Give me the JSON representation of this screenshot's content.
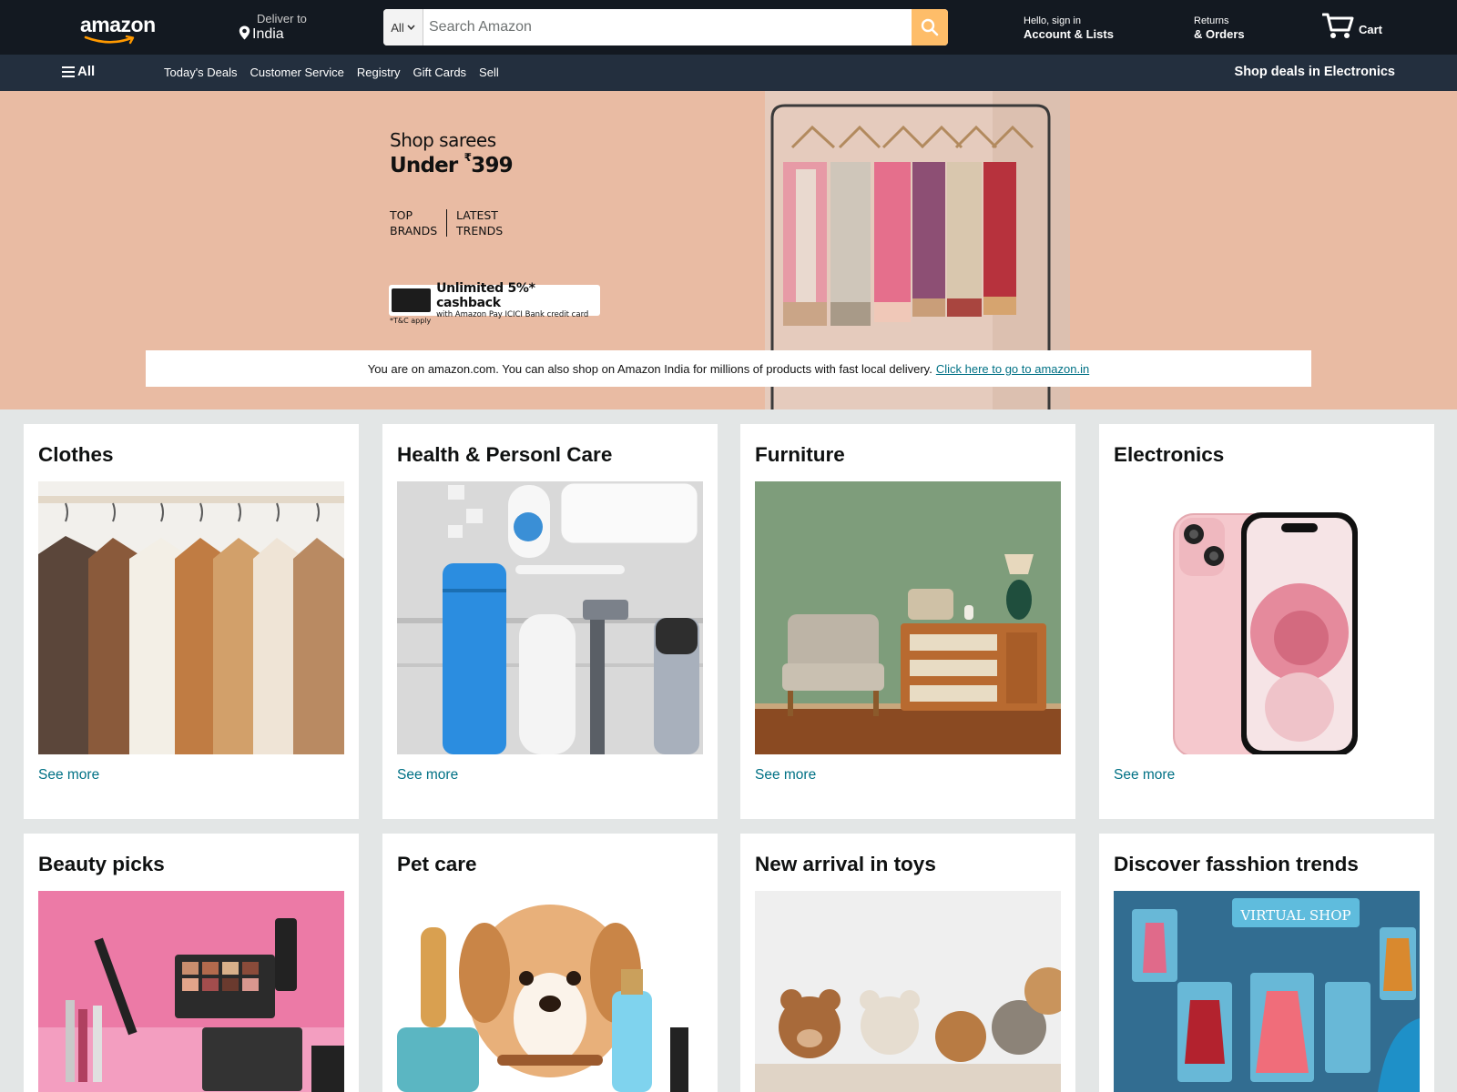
{
  "header": {
    "logo_text": "amazon",
    "deliver_label": "Deliver to",
    "deliver_location": "India",
    "search": {
      "category": "All",
      "placeholder": "Search Amazon"
    },
    "account": {
      "greeting": "Hello, sign in",
      "label": "Account & Lists"
    },
    "returns": {
      "line1": "Returns",
      "line2": "& Orders"
    },
    "cart": {
      "label": "Cart"
    }
  },
  "subnav": {
    "all_label": "All",
    "links": [
      "Today's Deals",
      "Customer Service",
      "Registry",
      "Gift Cards",
      "Sell"
    ],
    "promo": "Shop deals in Electronics"
  },
  "hero": {
    "line1": "Shop sarees",
    "price_prefix": "Under ",
    "price_symbol": "₹",
    "price_value": "399",
    "tag_left_1": "TOP",
    "tag_left_2": "BRANDS",
    "tag_right_1": "LATEST",
    "tag_right_2": "TRENDS",
    "cashback_line1": "Unlimited 5%* cashback",
    "cashback_line2": "with Amazon Pay ICICI Bank credit card",
    "tc": "*T&C apply",
    "colors": {
      "background": "#e9bba3"
    }
  },
  "notice": {
    "text": "You are on amazon.com. You can also shop on Amazon India for millions of products with fast local delivery.",
    "link": "Click here to go to amazon.in"
  },
  "cards": [
    {
      "title": "Clothes",
      "link": "See more"
    },
    {
      "title": "Health & Personl Care",
      "link": "See more"
    },
    {
      "title": "Furniture",
      "link": "See more"
    },
    {
      "title": "Electronics",
      "link": "See more"
    },
    {
      "title": "Beauty picks"
    },
    {
      "title": "Pet care"
    },
    {
      "title": "New arrival in toys"
    },
    {
      "title": "Discover fasshion trends",
      "virtual_shop_sign": "VIRTUAL SHOP"
    }
  ],
  "colors": {
    "nav_top": "#131921",
    "nav_sub": "#232f3e",
    "search_button": "#febd69",
    "link": "#007185",
    "page_background": "#e3e6e6"
  }
}
